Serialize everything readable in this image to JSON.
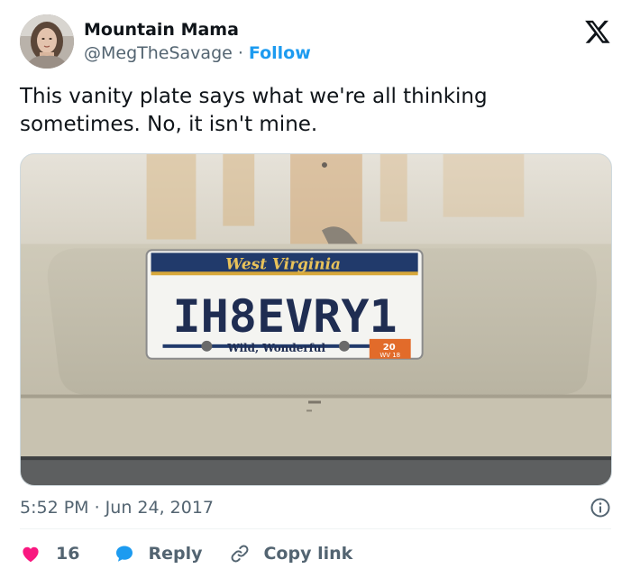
{
  "user": {
    "display_name": "Mountain Mama",
    "handle": "@MegTheSavage",
    "separator": "·",
    "follow_label": "Follow"
  },
  "tweet": {
    "text": "This vanity plate says what we're all thinking sometimes. No, it isn't mine.",
    "timestamp": "5:52 PM · Jun 24, 2017"
  },
  "media": {
    "plate_state": "West Virginia",
    "plate_text": "IH8EVRY1",
    "plate_slogan": "Wild, Wonderful",
    "sticker_year": "20",
    "sticker_code": "WV 18"
  },
  "actions": {
    "like_count": "16",
    "reply_label": "Reply",
    "copy_label": "Copy link"
  },
  "icons": {
    "close": "x-logo-icon",
    "info": "info-icon",
    "like": "heart-icon",
    "reply": "chat-bubble-icon",
    "copy": "link-icon"
  },
  "colors": {
    "accent": "#1d9bf0",
    "like": "#f91880",
    "text": "#0f1419",
    "muted": "#536471"
  }
}
